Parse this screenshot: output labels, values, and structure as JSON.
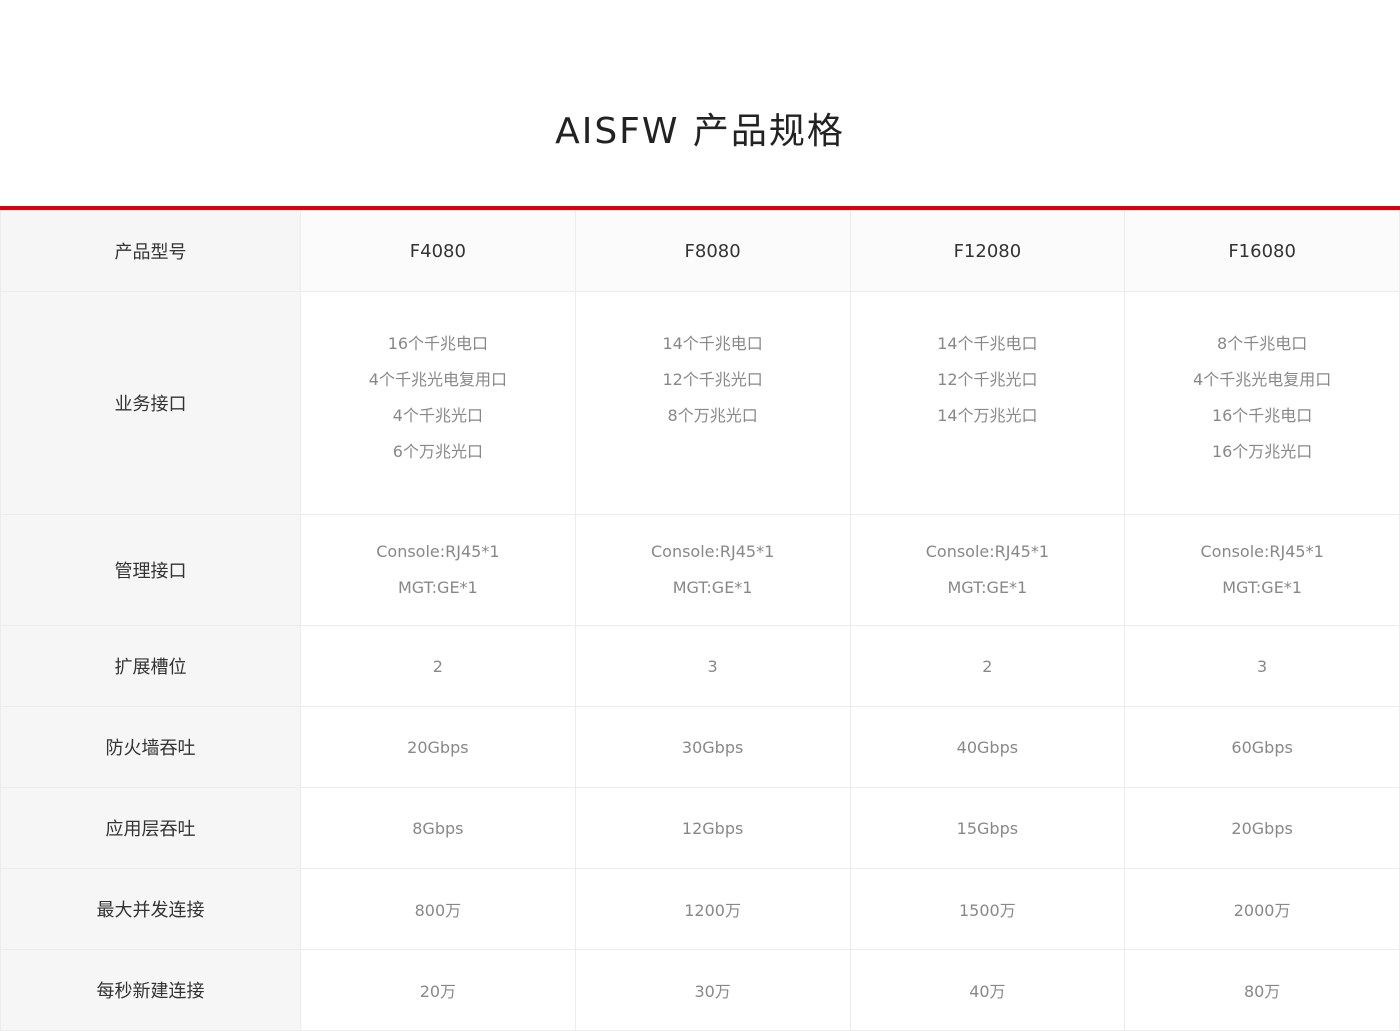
{
  "page_title": "AISFW 产品规格",
  "colors": {
    "accent_rule": "#d7000f",
    "label_bg": "#f6f6f6",
    "value_text": "#888888",
    "label_text": "#333333"
  },
  "table": {
    "header": {
      "label": "产品型号",
      "models": [
        "F4080",
        "F8080",
        "F12080",
        "F16080"
      ]
    },
    "rows": [
      {
        "label": "业务接口",
        "cells": [
          [
            "16个千兆电口",
            "4个千兆光电复用口",
            "4个千兆光口",
            "6个万兆光口"
          ],
          [
            "14个千兆电口",
            "12个千兆光口",
            "8个万兆光口"
          ],
          [
            "14个千兆电口",
            "12个千兆光口",
            "14个万兆光口"
          ],
          [
            "8个千兆电口",
            "4个千兆光电复用口",
            "16个千兆电口",
            "16个万兆光口"
          ]
        ]
      },
      {
        "label": "管理接口",
        "cells": [
          [
            "Console:RJ45*1",
            "MGT:GE*1"
          ],
          [
            "Console:RJ45*1",
            "MGT:GE*1"
          ],
          [
            "Console:RJ45*1",
            "MGT:GE*1"
          ],
          [
            "Console:RJ45*1",
            "MGT:GE*1"
          ]
        ]
      },
      {
        "label": "扩展槽位",
        "cells": [
          "2",
          "3",
          "2",
          "3"
        ]
      },
      {
        "label": "防火墙吞吐",
        "cells": [
          "20Gbps",
          "30Gbps",
          "40Gbps",
          "60Gbps"
        ]
      },
      {
        "label": "应用层吞吐",
        "cells": [
          "8Gbps",
          "12Gbps",
          "15Gbps",
          "20Gbps"
        ]
      },
      {
        "label": "最大并发连接",
        "cells": [
          "800万",
          "1200万",
          "1500万",
          "2000万"
        ]
      },
      {
        "label": "每秒新建连接",
        "cells": [
          "20万",
          "30万",
          "40万",
          "80万"
        ]
      }
    ]
  }
}
